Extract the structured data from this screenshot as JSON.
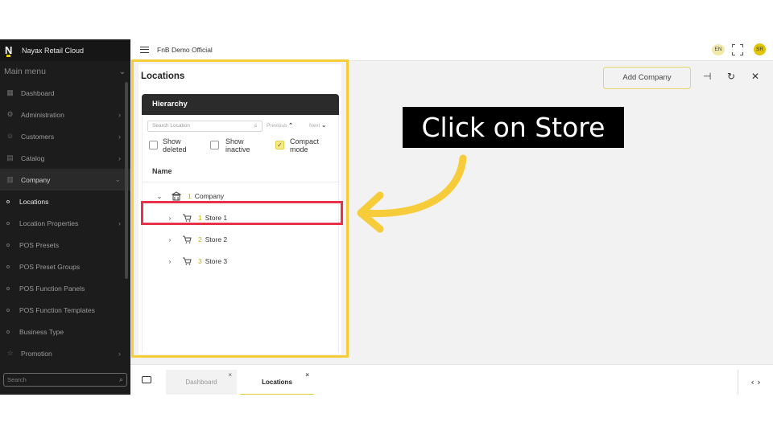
{
  "brand": {
    "name": "Nayax Retail Cloud",
    "logo_letter": "N"
  },
  "sidebar": {
    "main_menu_label": "Main menu",
    "items": [
      {
        "label": "Dashboard",
        "icon": "dashboard-icon",
        "has_arrow": false
      },
      {
        "label": "Administration",
        "icon": "gear-icon",
        "has_arrow": true
      },
      {
        "label": "Customers",
        "icon": "customers-icon",
        "has_arrow": true
      },
      {
        "label": "Catalog",
        "icon": "catalog-icon",
        "has_arrow": true
      },
      {
        "label": "Company",
        "icon": "company-icon",
        "has_arrow": true,
        "expanded": true
      }
    ],
    "company_sub": [
      {
        "label": "Locations",
        "active": true
      },
      {
        "label": "Location Properties",
        "has_arrow": true
      },
      {
        "label": "POS Presets"
      },
      {
        "label": "POS Preset Groups"
      },
      {
        "label": "POS Function Panels"
      },
      {
        "label": "POS Function Templates"
      },
      {
        "label": "Business Type"
      }
    ],
    "promotion": {
      "label": "Promotion",
      "icon": "star-icon"
    },
    "search_placeholder": "Search"
  },
  "topbar": {
    "org_name": "FnB Demo Official",
    "lang": "EN",
    "avatar_initials": "SR"
  },
  "locations": {
    "title": "Locations",
    "add_company_label": "Add Company",
    "hierarchy": {
      "header": "Hierarchy",
      "search_placeholder": "Search Location",
      "previous_label": "Previous",
      "next_label": "Next",
      "show_deleted_l1": "Show",
      "show_deleted_l2": "deleted",
      "show_inactive_l1": "Show",
      "show_inactive_l2": "inactive",
      "compact_mode_l1": "Compact",
      "compact_mode_l2": "mode",
      "compact_mode_checked": true,
      "name_header": "Name",
      "tree": [
        {
          "num": "1",
          "label": "Company",
          "type": "company"
        },
        {
          "num": "1",
          "label": "Store 1",
          "type": "store"
        },
        {
          "num": "2",
          "label": "Store 2",
          "type": "store"
        },
        {
          "num": "3",
          "label": "Store 3",
          "type": "store"
        }
      ]
    }
  },
  "tabs": [
    {
      "label": "Dashboard",
      "active": false
    },
    {
      "label": "Locations",
      "active": true
    }
  ],
  "annotation": {
    "text": "Click on Store"
  },
  "colors": {
    "accent": "#e3cf3c",
    "highlight_yellow": "#f6cc3b",
    "highlight_red": "#e8324a",
    "sidebar_bg": "#1c1c1c"
  }
}
